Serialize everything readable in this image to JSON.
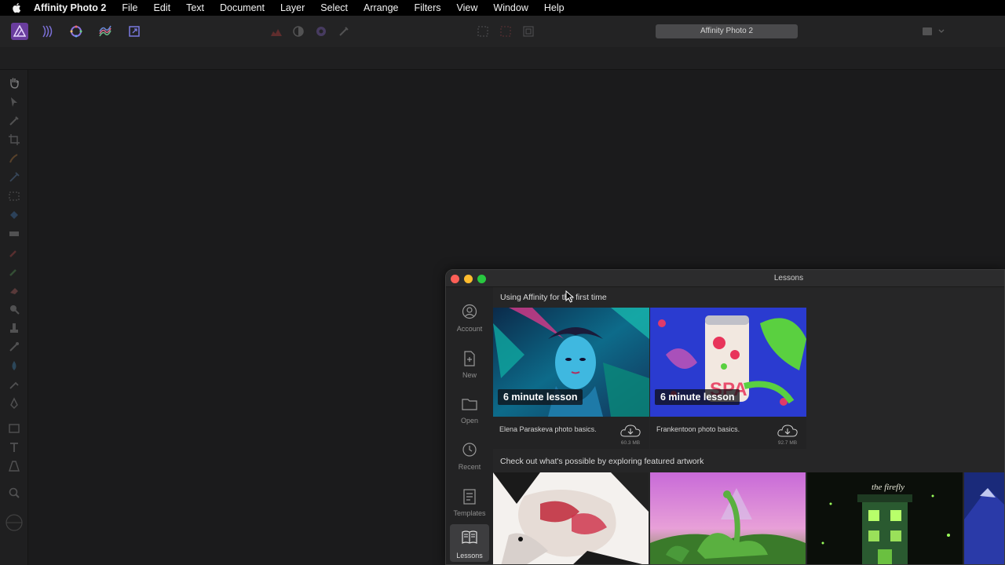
{
  "menubar": {
    "apple_icon": "apple-icon",
    "items": [
      "Affinity Photo 2",
      "File",
      "Edit",
      "Text",
      "Document",
      "Layer",
      "Select",
      "Arrange",
      "Filters",
      "View",
      "Window",
      "Help"
    ]
  },
  "toolbar": {
    "document_title": "Affinity Photo 2",
    "persona_icons": [
      "photo-persona-icon",
      "liquify-persona-icon",
      "develop-persona-icon",
      "tone-mapping-persona-icon",
      "export-persona-icon"
    ]
  },
  "lessons_window": {
    "title": "Lessons",
    "sidebar": [
      {
        "label": "Account",
        "icon": "account-icon"
      },
      {
        "label": "New",
        "icon": "new-document-icon"
      },
      {
        "label": "Open",
        "icon": "folder-icon"
      },
      {
        "label": "Recent",
        "icon": "clock-icon"
      },
      {
        "label": "Templates",
        "icon": "templates-icon"
      },
      {
        "label": "Lessons",
        "icon": "book-icon"
      }
    ],
    "section_first": "Using Affinity for the first time",
    "lessons": [
      {
        "badge": "6 minute lesson",
        "name": "Elena Paraskeva photo basics.",
        "size": "60.3 MB"
      },
      {
        "badge": "6 minute lesson",
        "name": "Frankentoon photo basics.",
        "size": "92.7 MB"
      }
    ],
    "section_featured": "Check out what's possible by exploring featured artwork"
  },
  "colors": {
    "accent": "#6a3d9e",
    "close": "#fe5f57",
    "minimize": "#febc2e",
    "zoom": "#28c840"
  }
}
